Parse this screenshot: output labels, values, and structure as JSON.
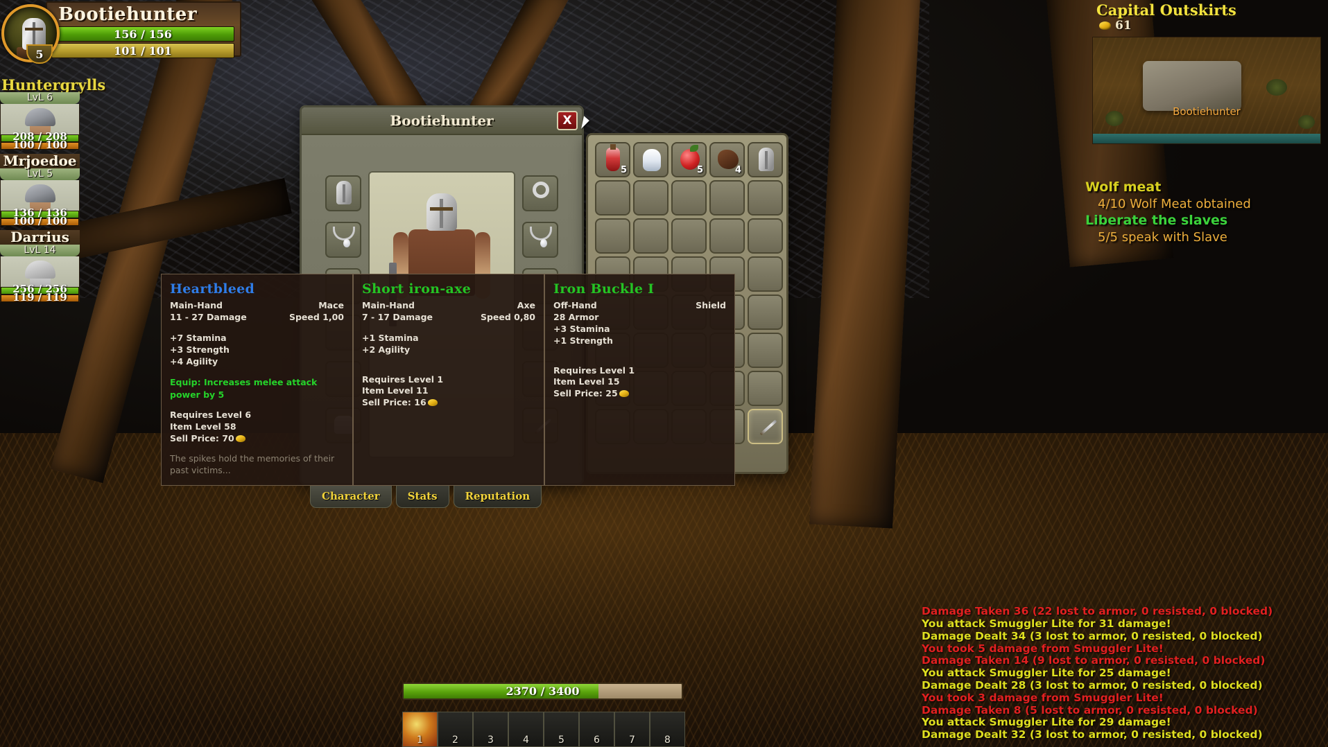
{
  "player": {
    "name": "Bootiehunter",
    "level": "5",
    "health": "156 / 156",
    "mana": "101 / 101"
  },
  "party": {
    "title": "Huntergrylls",
    "members": [
      {
        "name": "Huntergrylls",
        "level": "LvL 6",
        "health": "208 / 208",
        "mana": "100 / 100"
      },
      {
        "name": "Mrjoedoe",
        "level": "LvL 5",
        "health": "136 / 136",
        "mana": "100 / 100"
      },
      {
        "name": "Darrius",
        "level": "LvL 14",
        "health": "256 / 256",
        "mana": "119 / 119"
      }
    ]
  },
  "zone": {
    "name": "Capital Outskirts",
    "gold": "61",
    "minimap_player_label": "Bootiehunter"
  },
  "quests": [
    {
      "title": "Wolf meat",
      "title_color": "#d8d020",
      "objective": "4/10 Wolf Meat obtained"
    },
    {
      "title": "Liberate the slaves",
      "title_color": "#3bd23b",
      "objective": "5/5 speak with Slave"
    }
  ],
  "character_window": {
    "title": "Bootiehunter",
    "close_label": "X",
    "tabs": [
      {
        "label": "Character",
        "active": true
      },
      {
        "label": "Stats",
        "active": false
      },
      {
        "label": "Reputation",
        "active": false
      }
    ],
    "left_slots": [
      "helm-icon",
      "neck-icon",
      "shoulders-icon",
      "back-icon",
      "chest-icon",
      "shirt-icon"
    ],
    "right_slots": [
      "ring-icon",
      "amulet-icon",
      "gloves-icon",
      "belt-icon",
      "legs-icon",
      "boots-icon"
    ]
  },
  "inventory": {
    "slots": [
      {
        "icon": "potion-icon",
        "count": "5"
      },
      {
        "icon": "milk-icon",
        "count": ""
      },
      {
        "icon": "apple-icon",
        "count": "5"
      },
      {
        "icon": "meat-icon",
        "count": "4"
      },
      {
        "icon": "helm-icon",
        "count": ""
      },
      {
        "icon": "",
        "count": ""
      },
      {
        "icon": "",
        "count": ""
      },
      {
        "icon": "",
        "count": ""
      },
      {
        "icon": "",
        "count": ""
      },
      {
        "icon": "",
        "count": ""
      },
      {
        "icon": "",
        "count": ""
      },
      {
        "icon": "",
        "count": ""
      },
      {
        "icon": "",
        "count": ""
      },
      {
        "icon": "",
        "count": ""
      },
      {
        "icon": "",
        "count": ""
      },
      {
        "icon": "",
        "count": ""
      },
      {
        "icon": "",
        "count": ""
      },
      {
        "icon": "",
        "count": ""
      },
      {
        "icon": "",
        "count": ""
      },
      {
        "icon": "",
        "count": ""
      },
      {
        "icon": "",
        "count": ""
      },
      {
        "icon": "",
        "count": ""
      },
      {
        "icon": "",
        "count": ""
      },
      {
        "icon": "",
        "count": ""
      },
      {
        "icon": "",
        "count": ""
      },
      {
        "icon": "",
        "count": ""
      },
      {
        "icon": "",
        "count": ""
      },
      {
        "icon": "",
        "count": ""
      },
      {
        "icon": "",
        "count": ""
      },
      {
        "icon": "",
        "count": ""
      },
      {
        "icon": "",
        "count": ""
      },
      {
        "icon": "",
        "count": ""
      },
      {
        "icon": "",
        "count": ""
      },
      {
        "icon": "",
        "count": ""
      },
      {
        "icon": "",
        "count": ""
      },
      {
        "icon": "",
        "count": ""
      },
      {
        "icon": "",
        "count": ""
      },
      {
        "icon": "",
        "count": ""
      },
      {
        "icon": "",
        "count": ""
      },
      {
        "icon": "dagger-icon",
        "count": ""
      }
    ]
  },
  "tooltips": [
    {
      "name": "Heartbleed",
      "name_color": "#2f7de8",
      "slot": "Main-Hand",
      "type": "Mace",
      "damage": "11 - 27 Damage",
      "speed": "Speed 1,00",
      "stats": [
        "+7 Stamina",
        "+3 Strength",
        "+4 Agility"
      ],
      "effect": "Equip: Increases melee attack power by 5",
      "requires": "Requires Level 6",
      "item_level": "Item Level 58",
      "sell_price": "Sell Price: 70",
      "flavor": "The spikes hold the memories of their past victims..."
    },
    {
      "name": "Short iron-axe",
      "name_color": "#24c424",
      "slot": "Main-Hand",
      "type": "Axe",
      "damage": "7 - 17 Damage",
      "speed": "Speed 0,80",
      "stats": [
        "+1 Stamina",
        "+2 Agility"
      ],
      "effect": "",
      "requires": "Requires Level 1",
      "item_level": "Item Level 11",
      "sell_price": "Sell Price: 16",
      "flavor": ""
    },
    {
      "name": "Iron Buckle I",
      "name_color": "#24c424",
      "slot": "Off-Hand",
      "type": "Shield",
      "damage": "28 Armor",
      "speed": "",
      "stats": [
        "+3 Stamina",
        "+1 Strength"
      ],
      "effect": "",
      "requires": "Requires Level 1",
      "item_level": "Item Level 15",
      "sell_price": "Sell Price: 25",
      "flavor": ""
    }
  ],
  "combat_log": [
    {
      "text": "Damage Taken 36 (22 lost to armor, 0 resisted, 0 blocked)",
      "color": "#e02020"
    },
    {
      "text": "You attack Smuggler Lite for 31 damage!",
      "color": "#dede20"
    },
    {
      "text": "Damage Dealt 34 (3 lost to armor, 0 resisted, 0 blocked)",
      "color": "#dede20"
    },
    {
      "text": "You took 5 damage from Smuggler Lite!",
      "color": "#e02020"
    },
    {
      "text": "Damage Taken 14 (9 lost to armor, 0 resisted, 0 blocked)",
      "color": "#e02020"
    },
    {
      "text": "You attack Smuggler Lite for 25 damage!",
      "color": "#dede20"
    },
    {
      "text": "Damage Dealt 28 (3 lost to armor, 0 resisted, 0 blocked)",
      "color": "#dede20"
    },
    {
      "text": "You took 3 damage from Smuggler Lite!",
      "color": "#e02020"
    },
    {
      "text": "Damage Taken 8 (5 lost to armor, 0 resisted, 0 blocked)",
      "color": "#e02020"
    },
    {
      "text": "You attack Smuggler Lite for 29 damage!",
      "color": "#dede20"
    },
    {
      "text": "Damage Dealt 32 (3 lost to armor, 0 resisted, 0 blocked)",
      "color": "#dede20"
    }
  ],
  "xp_bar": {
    "text": "2370 / 3400",
    "percent": 70
  },
  "action_bar": {
    "slots": [
      {
        "key": "1",
        "filled": true
      },
      {
        "key": "2",
        "filled": false
      },
      {
        "key": "3",
        "filled": false
      },
      {
        "key": "4",
        "filled": false
      },
      {
        "key": "5",
        "filled": false
      },
      {
        "key": "6",
        "filled": false
      },
      {
        "key": "7",
        "filled": false
      },
      {
        "key": "8",
        "filled": false
      }
    ]
  }
}
